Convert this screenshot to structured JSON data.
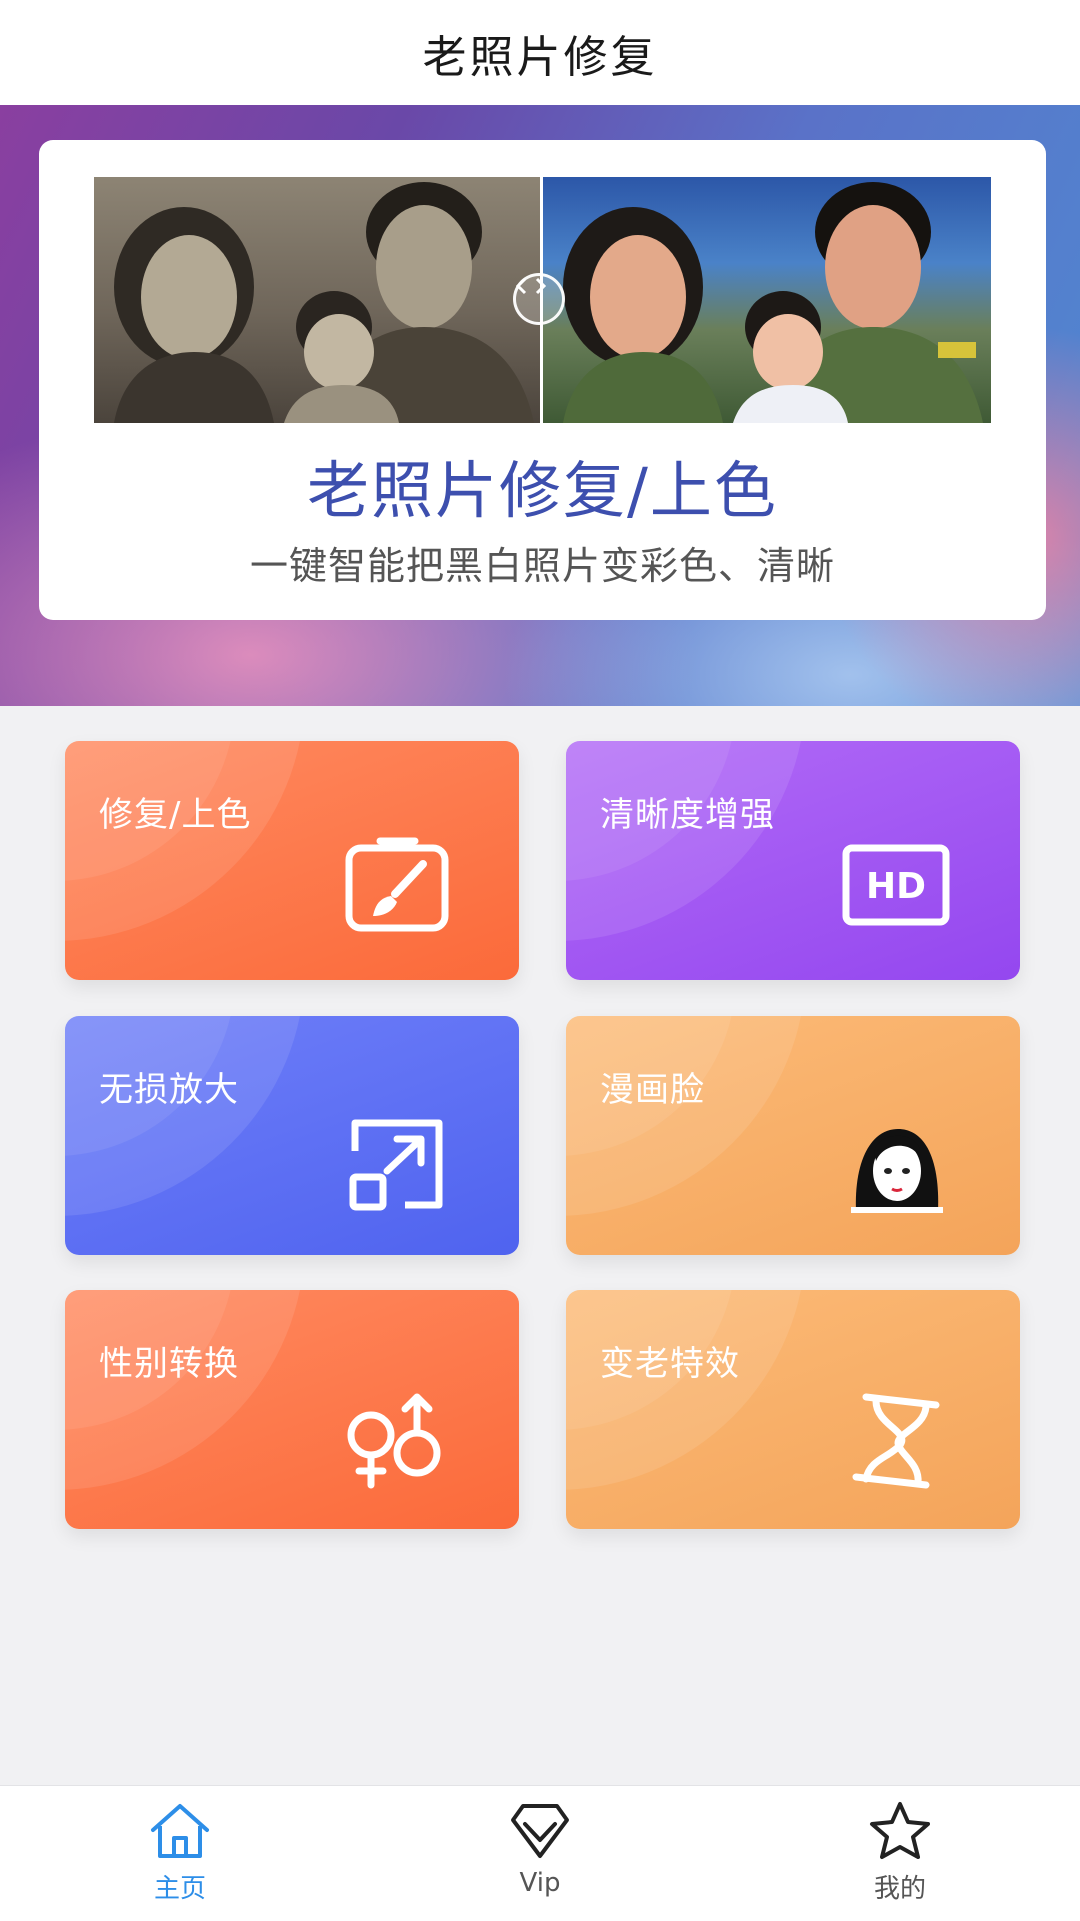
{
  "header": {
    "title": "老照片修复"
  },
  "banner": {
    "title": "老照片修复/上色",
    "subtitle": "一键智能把黑白照片变彩色、清晰"
  },
  "features": [
    {
      "label": "修复/上色",
      "icon": "paint-brush-frame-icon"
    },
    {
      "label": "清晰度增强",
      "icon": "hd-icon"
    },
    {
      "label": "无损放大",
      "icon": "expand-arrow-icon"
    },
    {
      "label": "漫画脸",
      "icon": "cartoon-face-icon"
    },
    {
      "label": "性别转换",
      "icon": "gender-symbols-icon"
    },
    {
      "label": "变老特效",
      "icon": "hourglass-icon"
    }
  ],
  "hd_badge": "HD",
  "bottom_nav": [
    {
      "label": "主页",
      "icon": "home-icon",
      "active": true
    },
    {
      "label": "Vip",
      "icon": "diamond-icon",
      "active": false
    },
    {
      "label": "我的",
      "icon": "star-icon",
      "active": false
    }
  ],
  "colors": {
    "accent": "#2d8ee8",
    "banner_title": "#3d4fae",
    "tile_orange": "#fb6a3a",
    "tile_purple": "#9447ef",
    "tile_blue": "#4f63ef",
    "tile_peach": "#f4a45a"
  }
}
